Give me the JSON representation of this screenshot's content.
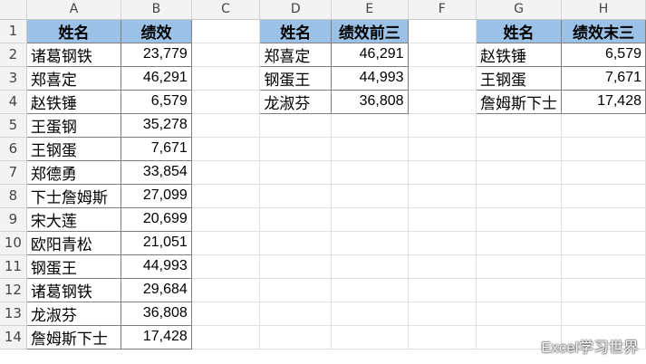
{
  "columns": [
    "A",
    "B",
    "C",
    "D",
    "E",
    "F",
    "G",
    "H"
  ],
  "rows": [
    "1",
    "2",
    "3",
    "4",
    "5",
    "6",
    "7",
    "8",
    "9",
    "10",
    "11",
    "12",
    "13",
    "14"
  ],
  "table_main": {
    "headers": [
      "姓名",
      "绩效"
    ],
    "data": [
      [
        "诸葛钢铁",
        "23,779"
      ],
      [
        "郑喜定",
        "46,291"
      ],
      [
        "赵铁锤",
        "6,579"
      ],
      [
        "王蛋钢",
        "35,278"
      ],
      [
        "王钢蛋",
        "7,671"
      ],
      [
        "郑德勇",
        "33,854"
      ],
      [
        "下士詹姆斯",
        "27,099"
      ],
      [
        "宋大莲",
        "20,699"
      ],
      [
        "欧阳青松",
        "21,051"
      ],
      [
        "钢蛋王",
        "44,993"
      ],
      [
        "诸葛钢铁",
        "29,684"
      ],
      [
        "龙淑芬",
        "36,808"
      ],
      [
        "詹姆斯下士",
        "17,428"
      ]
    ]
  },
  "table_top": {
    "headers": [
      "姓名",
      "绩效前三"
    ],
    "data": [
      [
        "郑喜定",
        "46,291"
      ],
      [
        "钢蛋王",
        "44,993"
      ],
      [
        "龙淑芬",
        "36,808"
      ]
    ]
  },
  "table_bottom": {
    "headers": [
      "姓名",
      "绩效末三"
    ],
    "data": [
      [
        "赵铁锤",
        "6,579"
      ],
      [
        "王钢蛋",
        "7,671"
      ],
      [
        "詹姆斯下士",
        "17,428"
      ]
    ]
  },
  "watermark": "Excel学习世界",
  "colors": {
    "header_fill": "#9bc2e6",
    "grid": "#e0e0e0",
    "border": "#7f7f7f"
  }
}
